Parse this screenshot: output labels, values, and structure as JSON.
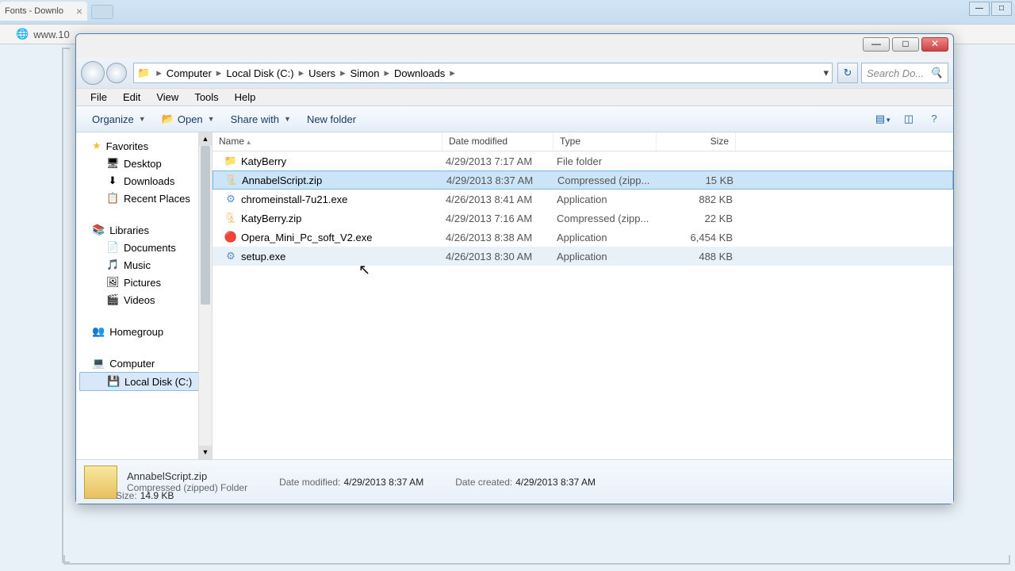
{
  "browser": {
    "tab_title": "Fonts - Downlo",
    "url": "www.10"
  },
  "titlebar": {
    "min": "—",
    "max": "□",
    "close": "✕"
  },
  "nav": {
    "breadcrumbs": [
      "Computer",
      "Local Disk (C:)",
      "Users",
      "Simon",
      "Downloads"
    ],
    "search_placeholder": "Search Do..."
  },
  "menu": {
    "file": "File",
    "edit": "Edit",
    "view": "View",
    "tools": "Tools",
    "help": "Help"
  },
  "toolbar": {
    "organize": "Organize",
    "open": "Open",
    "sharewith": "Share with",
    "newfolder": "New folder"
  },
  "navpane": {
    "favorites": {
      "label": "Favorites",
      "items": [
        "Desktop",
        "Downloads",
        "Recent Places"
      ]
    },
    "libraries": {
      "label": "Libraries",
      "items": [
        "Documents",
        "Music",
        "Pictures",
        "Videos"
      ]
    },
    "homegroup": {
      "label": "Homegroup"
    },
    "computer": {
      "label": "Computer",
      "items": [
        "Local Disk (C:)"
      ]
    }
  },
  "columns": {
    "name": "Name",
    "date": "Date modified",
    "type": "Type",
    "size": "Size"
  },
  "files": [
    {
      "icon": "folder",
      "name": "KatyBerry",
      "date": "4/29/2013 7:17 AM",
      "type": "File folder",
      "size": ""
    },
    {
      "icon": "zip",
      "name": "AnnabelScript.zip",
      "date": "4/29/2013 8:37 AM",
      "type": "Compressed (zipp...",
      "size": "15 KB",
      "selected": true
    },
    {
      "icon": "exe",
      "name": "chromeinstall-7u21.exe",
      "date": "4/26/2013 8:41 AM",
      "type": "Application",
      "size": "882 KB"
    },
    {
      "icon": "zip",
      "name": "KatyBerry.zip",
      "date": "4/29/2013 7:16 AM",
      "type": "Compressed (zipp...",
      "size": "22 KB"
    },
    {
      "icon": "opera",
      "name": "Opera_Mini_Pc_soft_V2.exe",
      "date": "4/26/2013 8:38 AM",
      "type": "Application",
      "size": "6,454 KB"
    },
    {
      "icon": "exe",
      "name": "setup.exe",
      "date": "4/26/2013 8:30 AM",
      "type": "Application",
      "size": "488 KB",
      "hover": true
    }
  ],
  "details": {
    "name": "AnnabelScript.zip",
    "type": "Compressed (zipped) Folder",
    "mod_label": "Date modified:",
    "mod": "4/29/2013 8:37 AM",
    "created_label": "Date created:",
    "created": "4/29/2013 8:37 AM",
    "size_label": "Size:",
    "size": "14.9 KB"
  }
}
